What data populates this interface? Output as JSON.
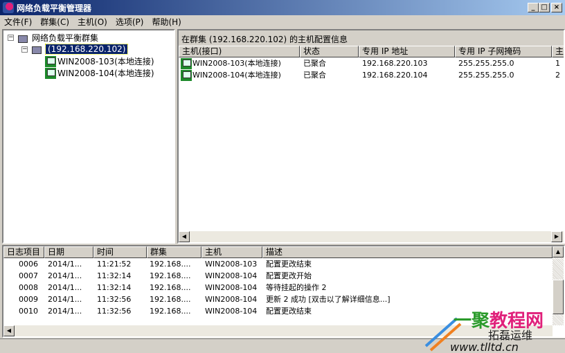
{
  "window": {
    "title": "网络负载平衡管理器",
    "minimize": "_",
    "maximize": "□",
    "close": "×"
  },
  "menu": [
    "文件(F)",
    "群集(C)",
    "主机(O)",
    "选项(P)",
    "帮助(H)"
  ],
  "tree": {
    "root": "网络负载平衡群集",
    "cluster": "(192.168.220.102)",
    "hosts": [
      "WIN2008-103(本地连接)",
      "WIN2008-104(本地连接)"
    ]
  },
  "hostpane": {
    "header": "在群集  (192.168.220.102) 的主机配置信息",
    "columns": [
      "主机(接口)",
      "状态",
      "专用 IP 地址",
      "专用 IP 子网掩码",
      "主"
    ],
    "rows": [
      [
        "WIN2008-103(本地连接)",
        "已聚合",
        "192.168.220.103",
        "255.255.255.0",
        "1"
      ],
      [
        "WIN2008-104(本地连接)",
        "已聚合",
        "192.168.220.104",
        "255.255.255.0",
        "2"
      ]
    ]
  },
  "log": {
    "columns": [
      "日志项目",
      "日期",
      "时间",
      "群集",
      "主机",
      "描述"
    ],
    "rows": [
      [
        "0006",
        "2014/1...",
        "11:21:52",
        "192.168....",
        "WIN2008-103",
        "配置更改结束"
      ],
      [
        "0007",
        "2014/1...",
        "11:32:14",
        "192.168....",
        "WIN2008-104",
        "配置更改开始"
      ],
      [
        "0008",
        "2014/1...",
        "11:32:14",
        "192.168....",
        "WIN2008-104",
        "等待挂起的操作 2"
      ],
      [
        "0009",
        "2014/1...",
        "11:32:56",
        "192.168....",
        "WIN2008-104",
        "更新 2 成功 [双击以了解详细信息...]"
      ],
      [
        "0010",
        "2014/1...",
        "11:32:56",
        "192.168....",
        "WIN2008-104",
        "配置更改结束"
      ]
    ]
  },
  "watermark": {
    "line1": "一聚教程网",
    "line2": "拓磊运维",
    "line3": "www.tlltd.cn"
  },
  "colors": {
    "titlebar": "#0a246a",
    "selection": "#0a246a",
    "host_icon": "#1c8a2a"
  }
}
